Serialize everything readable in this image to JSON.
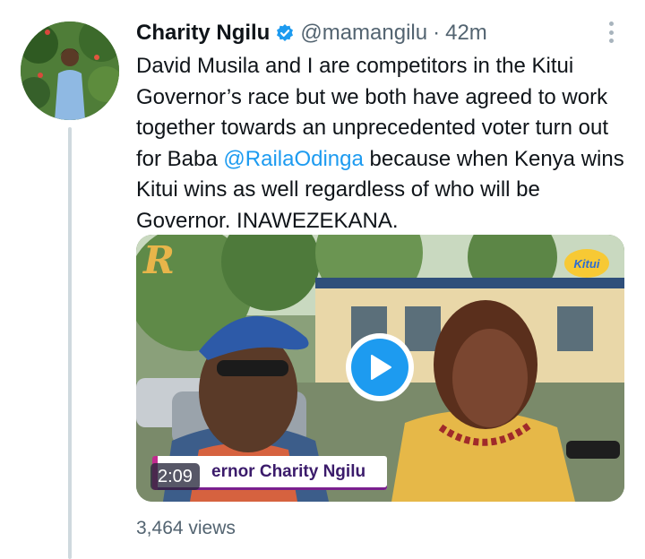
{
  "tweet": {
    "author_name": "Charity Ngilu",
    "handle": "@mamangilu",
    "separator": "·",
    "time": "42m",
    "text_before": "David Musila and I are competitors in the Kitui Governor’s race but we both have agreed to work together towards an unprecedented voter turn out for Baba ",
    "mention": "@RailaOdinga",
    "text_after": " because when Kenya wins Kitui wins as well regardless of who will be Governor. INAWEZEKANA.",
    "views": "3,464 views"
  },
  "video": {
    "duration": "2:09",
    "caption": "ernor Charity Ngilu",
    "logo_left": "R",
    "logo_right": "Kitui"
  },
  "icons": {
    "verified": "verified-badge-icon",
    "more": "more-options-icon",
    "play": "play-icon"
  },
  "colors": {
    "accent": "#1d9bf0",
    "secondary_text": "#536471",
    "primary_text": "#0f1419",
    "thread_line": "#cfd9de"
  }
}
